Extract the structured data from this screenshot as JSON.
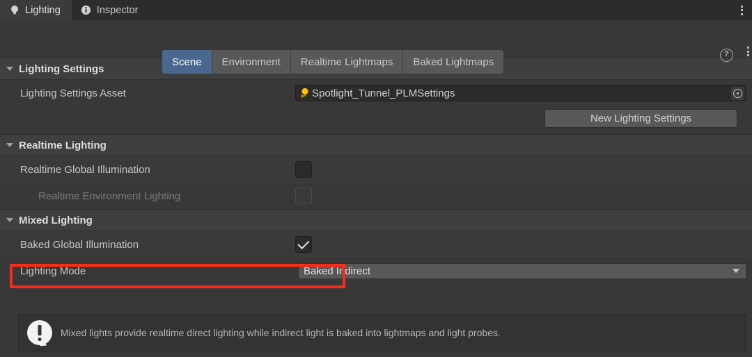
{
  "window": {
    "tabs": [
      {
        "label": "Lighting",
        "icon": "lightbulb-icon",
        "active": true
      },
      {
        "label": "Inspector",
        "icon": "info-circle-icon",
        "active": false
      }
    ],
    "menu_icon": "kebab-menu-icon"
  },
  "toolbar": {
    "pills": [
      {
        "label": "Scene",
        "selected": true
      },
      {
        "label": "Environment",
        "selected": false
      },
      {
        "label": "Realtime Lightmaps",
        "selected": false
      },
      {
        "label": "Baked Lightmaps",
        "selected": false
      }
    ],
    "help_icon": "help-question-icon",
    "help_glyph": "?",
    "menu_icon": "kebab-menu-icon"
  },
  "sections": {
    "lighting_settings": {
      "title": "Lighting Settings",
      "asset_label": "Lighting Settings Asset",
      "asset_value": "Spotlight_Tunnel_PLMSettings",
      "asset_icon": "lightbulb-asset-icon",
      "picker_icon": "object-picker-icon",
      "new_button": "New Lighting Settings"
    },
    "realtime_lighting": {
      "title": "Realtime Lighting",
      "rows": [
        {
          "label": "Realtime Global Illumination",
          "checked": false,
          "disabled": false
        },
        {
          "label": "Realtime Environment Lighting",
          "checked": false,
          "disabled": true
        }
      ]
    },
    "mixed_lighting": {
      "title": "Mixed Lighting",
      "baked_gi_label": "Baked Global Illumination",
      "baked_gi_checked": true,
      "lighting_mode_label": "Lighting Mode",
      "lighting_mode_value": "Baked Indirect",
      "dropdown_icon": "chevron-down-icon",
      "info_icon": "info-exclamation-icon",
      "info_text": "Mixed lights provide realtime direct lighting while indirect light is baked into lightmaps and light probes."
    }
  },
  "annotation": {
    "color": "#fc2a18",
    "target": "baked-global-illumination-row"
  }
}
